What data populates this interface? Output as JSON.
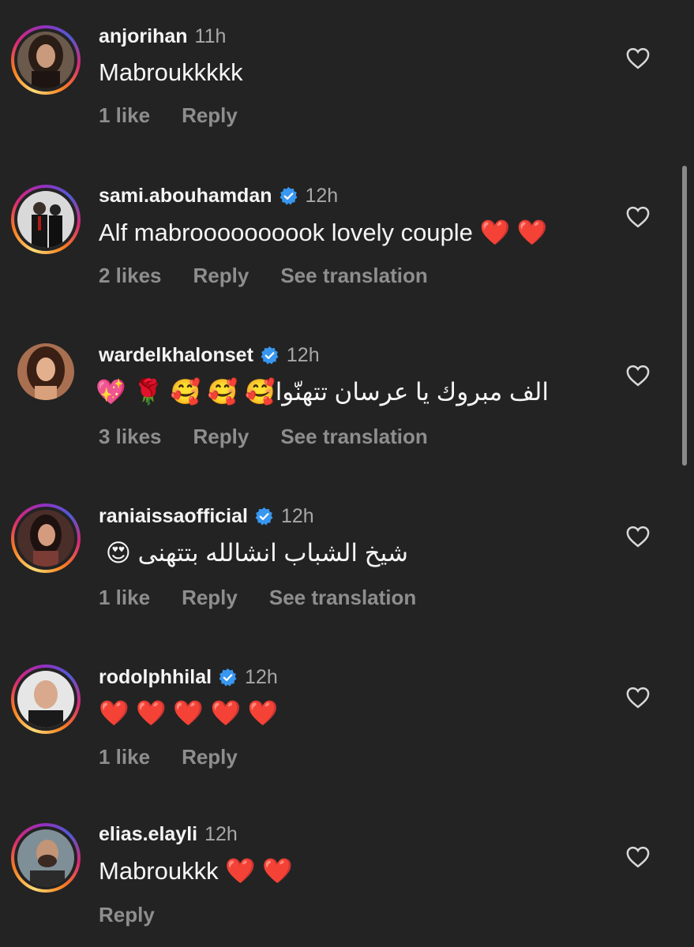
{
  "comments": [
    {
      "username": "anjorihan",
      "verified": false,
      "time": "11h",
      "text": "Mabroukkkkk",
      "likes": "1 like",
      "reply": "Reply",
      "translation": ""
    },
    {
      "username": "sami.abouhamdan",
      "verified": true,
      "time": "12h",
      "text": "Alf mabroooooooook lovely couple ❤️ ❤️",
      "likes": "2 likes",
      "reply": "Reply",
      "translation": "See translation"
    },
    {
      "username": "wardelkhalonset",
      "verified": true,
      "time": "12h",
      "text": "الف مبروك يا عرسان تتهنّوا🥰 🥰 🥰 🌹 💖",
      "likes": "3 likes",
      "reply": "Reply",
      "translation": "See translation"
    },
    {
      "username": "raniaissaofficial",
      "verified": true,
      "time": "12h",
      "text": "شيخ الشباب انشالله بتتهنى 😍",
      "likes": "1 like",
      "reply": "Reply",
      "translation": "See translation"
    },
    {
      "username": "rodolphhilal",
      "verified": true,
      "time": "12h",
      "text": "❤️ ❤️ ❤️ ❤️ ❤️",
      "likes": "1 like",
      "reply": "Reply",
      "translation": ""
    },
    {
      "username": "elias.elayli",
      "verified": false,
      "time": "12h",
      "text": "Mabroukkk ❤️ ❤️",
      "likes": "",
      "reply": "Reply",
      "translation": ""
    }
  ],
  "icons": {
    "like": "heart-outline-icon",
    "verified": "verified-badge-icon"
  },
  "colors": {
    "background": "#232323",
    "verified_blue": "#3897f0",
    "meta_gray": "#8e8e8e",
    "time_gray": "#a8a8a8"
  }
}
